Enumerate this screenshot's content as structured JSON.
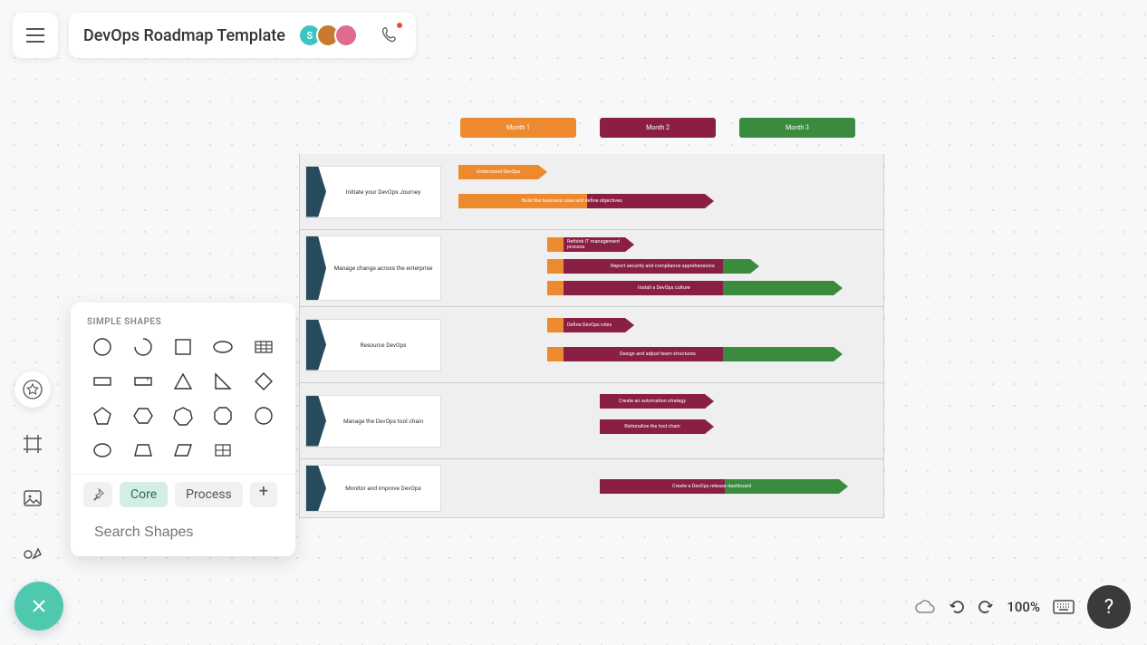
{
  "header": {
    "title": "DevOps Roadmap Template",
    "avatar1_initial": "S"
  },
  "shapes_panel": {
    "heading": "SIMPLE SHAPES",
    "tabs": {
      "core": "Core",
      "process": "Process"
    },
    "search_placeholder": "Search Shapes"
  },
  "months": {
    "m1": "Month 1",
    "m2": "Month 2",
    "m3": "Month 3"
  },
  "rows": {
    "r1": {
      "label": "Initiate your DevOps Journey",
      "bars": {
        "b1": "Understand DevOps",
        "b2": "Build the business case and define objectives"
      }
    },
    "r2": {
      "label": "Manage change across the enterprise",
      "bars": {
        "b1": "Rethink IT management process",
        "b2": "Report security and compliance apprehensions",
        "b3": "Install a DevOps culture"
      }
    },
    "r3": {
      "label": "Resource DevOps",
      "bars": {
        "b1": "Define DevOps roles",
        "b2": "Design and adjust team structures"
      }
    },
    "r4": {
      "label": "Manage the DevOps tool chain",
      "bars": {
        "b1": "Create an automation strategy",
        "b2": "Rationalize the tool chain"
      }
    },
    "r5": {
      "label": "Monitor and improve DevOps",
      "bars": {
        "b1": "Create a DevOps release dashboard"
      }
    }
  },
  "bottom": {
    "zoom": "100%",
    "help": "?"
  }
}
